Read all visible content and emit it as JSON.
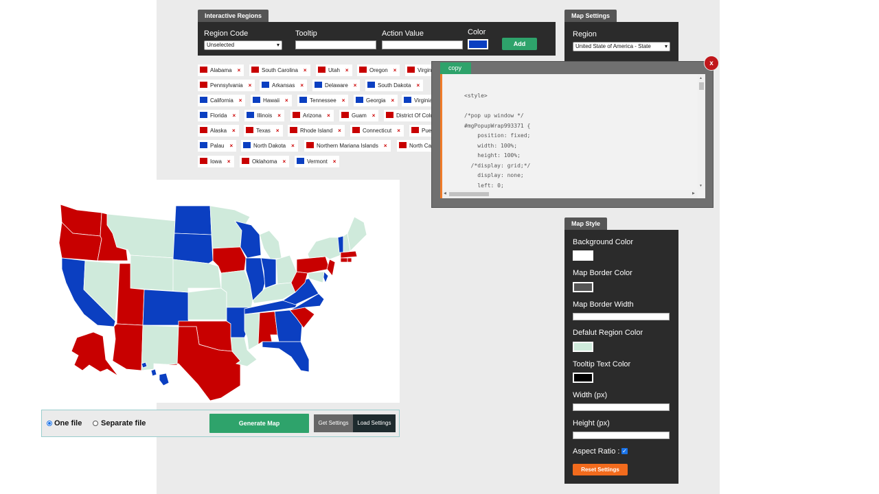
{
  "interactive_regions": {
    "tab_title": "Interactive Regions",
    "region_code_label": "Region Code",
    "region_code_value": "Unselected",
    "tooltip_label": "Tooltip",
    "action_value_label": "Action Value",
    "color_label": "Color",
    "color_value": "#0b3fc1",
    "add_label": "Add"
  },
  "regions": [
    {
      "name": "Alabama",
      "color": "#c80000"
    },
    {
      "name": "South Carolina",
      "color": "#c80000"
    },
    {
      "name": "Utah",
      "color": "#c80000"
    },
    {
      "name": "Oregon",
      "color": "#c80000"
    },
    {
      "name": "Virginia",
      "color": "#c80000"
    },
    {
      "name": "Pennsylvania",
      "color": "#c80000"
    },
    {
      "name": "Arkansas",
      "color": "#0b3fc1"
    },
    {
      "name": "Delaware",
      "color": "#0b3fc1"
    },
    {
      "name": "South Dakota",
      "color": "#0b3fc1"
    },
    {
      "name": "California",
      "color": "#0b3fc1"
    },
    {
      "name": "Hawaii",
      "color": "#0b3fc1"
    },
    {
      "name": "Tennessee",
      "color": "#0b3fc1"
    },
    {
      "name": "Georgia",
      "color": "#0b3fc1"
    },
    {
      "name": "Virginia",
      "color": "#0b3fc1"
    },
    {
      "name": "Florida",
      "color": "#0b3fc1"
    },
    {
      "name": "Illinois",
      "color": "#0b3fc1"
    },
    {
      "name": "Arizona",
      "color": "#c80000"
    },
    {
      "name": "Guam",
      "color": "#c80000"
    },
    {
      "name": "District Of Columbia",
      "color": "#c80000"
    },
    {
      "name": "Alaska",
      "color": "#c80000"
    },
    {
      "name": "Texas",
      "color": "#c80000"
    },
    {
      "name": "Rhode Island",
      "color": "#c80000"
    },
    {
      "name": "Connecticut",
      "color": "#c80000"
    },
    {
      "name": "Puerto Rico",
      "color": "#c80000"
    },
    {
      "name": "Palau",
      "color": "#0b3fc1"
    },
    {
      "name": "North Dakota",
      "color": "#0b3fc1"
    },
    {
      "name": "Northern Mariana Islands",
      "color": "#c80000"
    },
    {
      "name": "North Carolina",
      "color": "#c80000"
    },
    {
      "name": "Iowa",
      "color": "#c80000"
    },
    {
      "name": "Oklahoma",
      "color": "#c80000"
    },
    {
      "name": "Vermont",
      "color": "#0b3fc1"
    }
  ],
  "map_settings": {
    "tab_title": "Map Settings",
    "region_label": "Region",
    "region_value": "United State of America - State"
  },
  "map_style": {
    "tab_title": "Map Style",
    "background_color_label": "Background Color",
    "background_color": "#ffffff",
    "border_color_label": "Map Border Color",
    "border_color": "#555555",
    "border_width_label": "Map Border Width",
    "default_region_color_label": "Defalut Region Color",
    "default_region_color": "#cfeadb",
    "tooltip_text_color_label": "Tooltip Text Color",
    "tooltip_text_color": "#000000",
    "width_label": "Width (px)",
    "height_label": "Height (px)",
    "aspect_ratio_label": "Aspect Ratio :",
    "reset_label": "Reset Settings"
  },
  "output": {
    "one_file_label": "One file",
    "separate_file_label": "Separate file",
    "generate_label": "Generate Map",
    "get_settings_label": "Get Settings",
    "load_settings_label": "Load Settings"
  },
  "popup": {
    "copy_label": "copy",
    "close_label": "x",
    "code_lines": [
      "<style>",
      "",
      "/*pop up window */",
      "#mgPopupWrap993371 {",
      "    position: fixed;",
      "    width: 100%;",
      "    height: 100%;",
      "  /*display: grid;*/",
      "    display: none;",
      "    left: 0;"
    ]
  },
  "colors": {
    "red": "#c80000",
    "blue": "#0b3fc1",
    "default": "#cfeadb",
    "accent_green": "#2ea36b",
    "accent_orange": "#f26b1d"
  }
}
